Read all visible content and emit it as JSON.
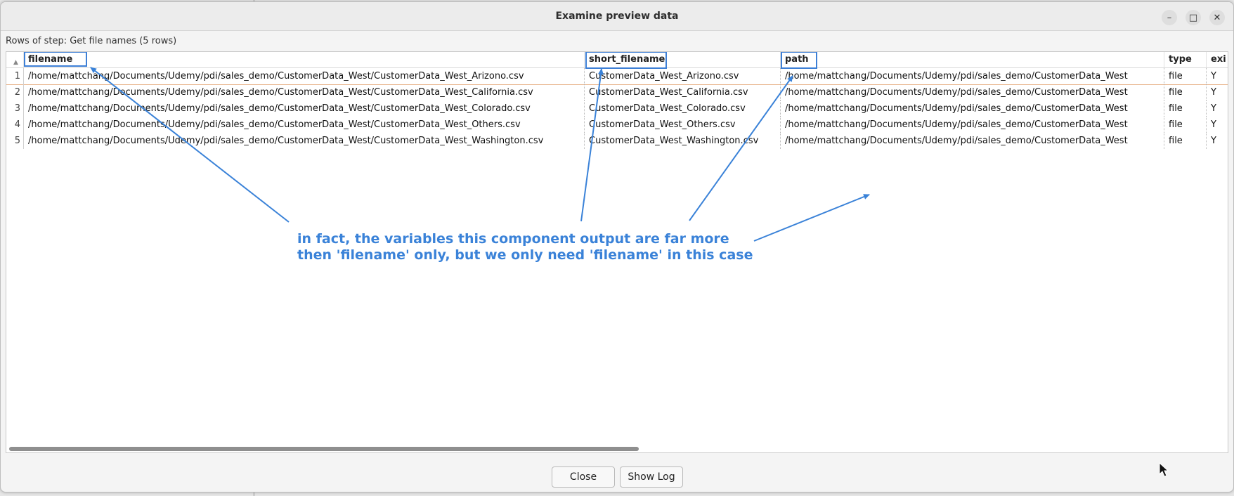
{
  "window": {
    "title": "Examine preview data"
  },
  "step_label": "Rows of step: Get file names (5 rows)",
  "table": {
    "columns": [
      "filename",
      "short_filename",
      "path",
      "type",
      "exi"
    ],
    "rows": [
      [
        "1",
        "/home/mattchang/Documents/Udemy/pdi/sales_demo/CustomerData_West/CustomerData_West_Arizono.csv",
        "CustomerData_West_Arizono.csv",
        "/home/mattchang/Documents/Udemy/pdi/sales_demo/CustomerData_West",
        "file",
        "Y"
      ],
      [
        "2",
        "/home/mattchang/Documents/Udemy/pdi/sales_demo/CustomerData_West/CustomerData_West_California.csv",
        "CustomerData_West_California.csv",
        "/home/mattchang/Documents/Udemy/pdi/sales_demo/CustomerData_West",
        "file",
        "Y"
      ],
      [
        "3",
        "/home/mattchang/Documents/Udemy/pdi/sales_demo/CustomerData_West/CustomerData_West_Colorado.csv",
        "CustomerData_West_Colorado.csv",
        "/home/mattchang/Documents/Udemy/pdi/sales_demo/CustomerData_West",
        "file",
        "Y"
      ],
      [
        "4",
        "/home/mattchang/Documents/Udemy/pdi/sales_demo/CustomerData_West/CustomerData_West_Others.csv",
        "CustomerData_West_Others.csv",
        "/home/mattchang/Documents/Udemy/pdi/sales_demo/CustomerData_West",
        "file",
        "Y"
      ],
      [
        "5",
        "/home/mattchang/Documents/Udemy/pdi/sales_demo/CustomerData_West/CustomerData_West_Washington.csv",
        "CustomerData_West_Washington.csv",
        "/home/mattchang/Documents/Udemy/pdi/sales_demo/CustomerData_West",
        "file",
        "Y"
      ]
    ]
  },
  "annotation": {
    "line1": "in fact, the variables this component output are far more",
    "line2": "then 'filename' only, but we only need 'filename' in this case"
  },
  "buttons": {
    "close": "Close",
    "show_log": "Show Log"
  },
  "icons": {
    "minimize": "minimize-icon",
    "maximize": "maximize-icon",
    "close": "close-icon",
    "sort": "sort-ascending-icon"
  },
  "colors": {
    "annotation": "#3a82d8",
    "row_separator": "#e8b38a"
  }
}
